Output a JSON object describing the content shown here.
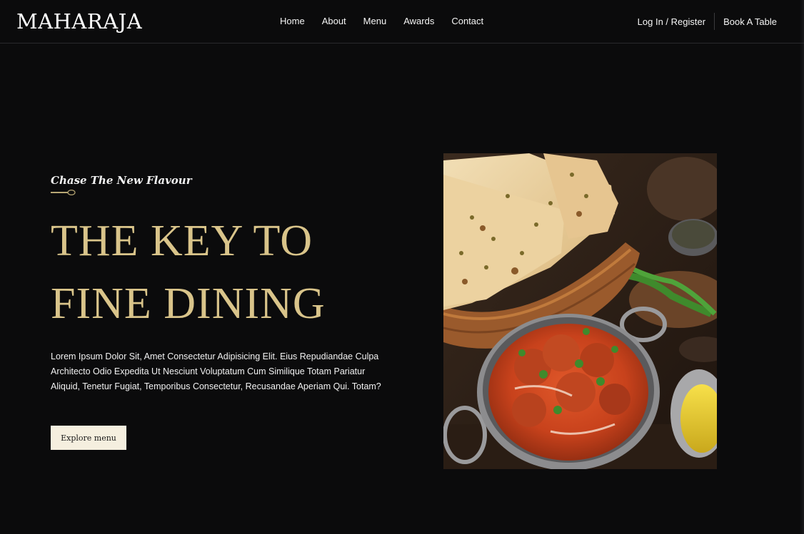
{
  "brand": {
    "logo": "MAHARAJA"
  },
  "nav": {
    "links": [
      "Home",
      "About",
      "Menu",
      "Awards",
      "Contact"
    ],
    "login_label": "Log In / Register",
    "book_label": "Book A Table"
  },
  "hero": {
    "tagline": "Chase The New Flavour",
    "title_line1": "THE KEY TO",
    "title_line2": "FINE DINING",
    "description": "Lorem Ipsum Dolor Sit, Amet Consectetur Adipisicing Elit. Eius Repudiandae Culpa Architecto Odio Expedita Ut Nesciunt Voluptatum Cum Similique Totam Pariatur Aliquid, Tenetur Fugiat, Temporibus Consectetur, Recusandae Aperiam Qui. Totam?",
    "cta_label": "Explore menu",
    "image_icon": "food-photo"
  },
  "colors": {
    "background": "#0b0b0c",
    "accent_gold": "#d9c48a",
    "button_bg": "#f5efdf",
    "text": "#f2f2f2"
  }
}
